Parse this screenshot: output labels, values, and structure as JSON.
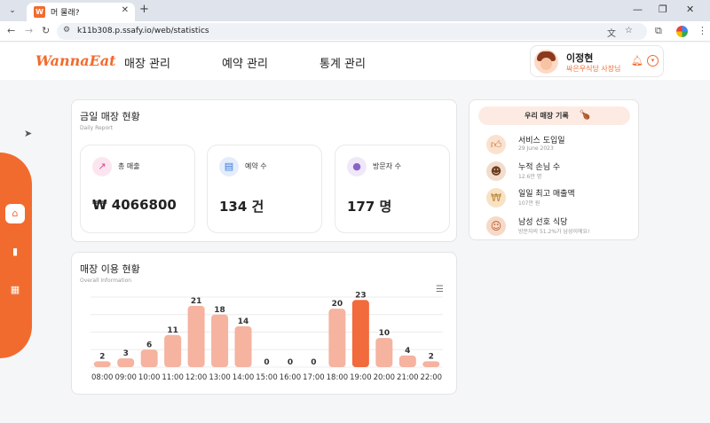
{
  "browser": {
    "tab_title": "머 물래?",
    "tab_favicon": "W",
    "url": "k11b308.p.ssafy.io/web/statistics"
  },
  "app": {
    "logo": "WannaEat",
    "nav": [
      "매장 관리",
      "예약 관리",
      "통계 관리"
    ],
    "user": {
      "name": "이정현",
      "role": "싸은우식당 사장님"
    }
  },
  "daily_report": {
    "title": "금일 매장 현황",
    "subtitle": "Daily Report",
    "stats": [
      {
        "label": "총 매출",
        "value": "₩ 4066800",
        "icon": "trend-up-icon",
        "color": "#e0458a"
      },
      {
        "label": "예약 수",
        "value": "134 건",
        "icon": "clipboard-icon",
        "color": "#3a78d8"
      },
      {
        "label": "방문자 수",
        "value": "177 명",
        "icon": "person-icon",
        "color": "#8a63c8"
      }
    ]
  },
  "records": {
    "title": "우리 매장 기록",
    "items": [
      {
        "title": "서비스 도입일",
        "sub": "29 June 2023",
        "icon": "thumbs-up-icon"
      },
      {
        "title": "누적 손님 수",
        "sub": "12.6만 명",
        "icon": "crowd-icon"
      },
      {
        "title": "일일 최고 매출액",
        "sub": "107만 원",
        "icon": "money-bag-icon"
      },
      {
        "title": "남성 선호 식당",
        "sub": "방문자의 51.2%가 남성이에요!",
        "icon": "man-icon"
      }
    ]
  },
  "overall": {
    "title": "매장 이용 현황",
    "subtitle": "Overall Information"
  },
  "chart_data": {
    "type": "bar",
    "categories": [
      "08:00",
      "09:00",
      "10:00",
      "11:00",
      "12:00",
      "13:00",
      "14:00",
      "15:00",
      "16:00",
      "17:00",
      "18:00",
      "19:00",
      "20:00",
      "21:00",
      "22:00"
    ],
    "values": [
      2,
      3,
      6,
      11,
      21,
      18,
      14,
      0,
      0,
      0,
      20,
      23,
      10,
      4,
      2
    ],
    "highlight_index": 11,
    "colors": {
      "bar": "#f5b3a0",
      "highlight": "#f26b3d"
    },
    "ylim": [
      0,
      24
    ],
    "grid": true,
    "title": "",
    "xlabel": "",
    "ylabel": ""
  }
}
